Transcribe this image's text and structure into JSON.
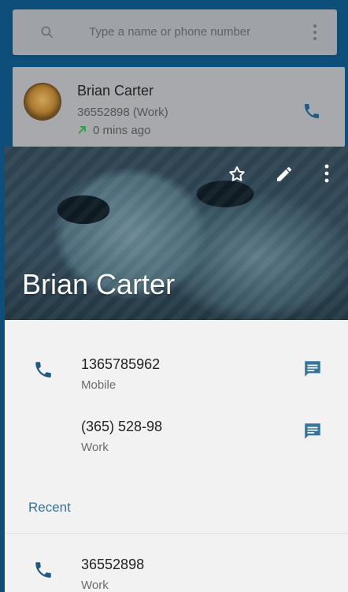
{
  "colors": {
    "accent": "#1f5b86",
    "message_icon": "#35729e",
    "missed_call_arrow": "#2ea34a"
  },
  "search": {
    "placeholder": "Type a name or phone number"
  },
  "recent_card": {
    "name": "Brian Carter",
    "number": "36552898 (Work)",
    "time": "0 mins ago"
  },
  "contact": {
    "name": "Brian Carter",
    "phones": [
      {
        "number": "1365785962",
        "type": "Mobile"
      },
      {
        "number": "(365) 528-98",
        "type": "Work"
      }
    ]
  },
  "recent": {
    "section_title": "Recent",
    "entries": [
      {
        "number": "36552898",
        "type": "Work"
      }
    ]
  }
}
